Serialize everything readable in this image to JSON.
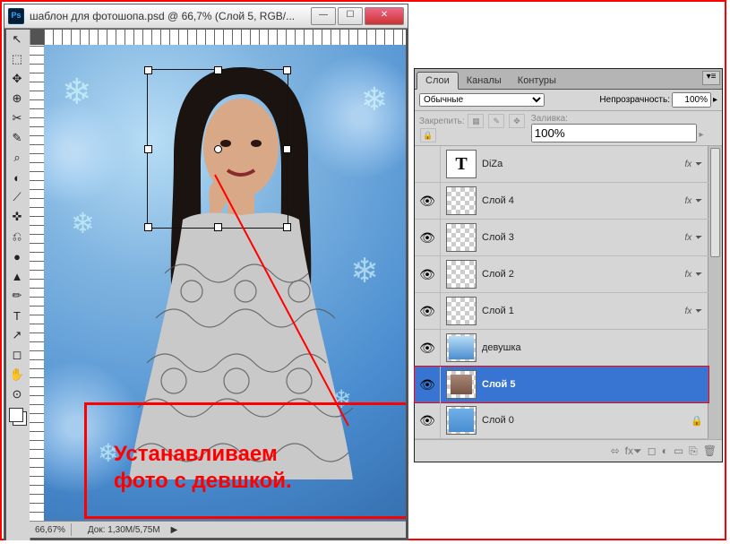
{
  "window": {
    "title": "шаблон для фотошопа.psd @ 66,7% (Слой 5, RGB/...",
    "minimize": "—",
    "maximize": "☐",
    "close": "✕"
  },
  "status": {
    "zoom": "66,67%",
    "doc_size": "Док: 1,30M/5,75M"
  },
  "callout": {
    "line1": "Устанавливаем",
    "line2": "фото с девшкой."
  },
  "panel": {
    "tabs": {
      "layers": "Слои",
      "channels": "Каналы",
      "paths": "Контуры"
    },
    "blend_mode": "Обычные",
    "opacity_label": "Непрозрачность:",
    "opacity_value": "100%",
    "lock_label": "Закрепить:",
    "fill_label": "Заливка:",
    "fill_value": "100%",
    "fx": "fx"
  },
  "layers": [
    {
      "name": "DiZa",
      "type": "text",
      "visible": false,
      "fx": true,
      "locked": false,
      "selected": false
    },
    {
      "name": "Слой 4",
      "type": "trans",
      "visible": true,
      "fx": true,
      "locked": false,
      "selected": false
    },
    {
      "name": "Слой 3",
      "type": "trans",
      "visible": true,
      "fx": true,
      "locked": false,
      "selected": false
    },
    {
      "name": "Слой 2",
      "type": "trans",
      "visible": true,
      "fx": true,
      "locked": false,
      "selected": false
    },
    {
      "name": "Слой 1",
      "type": "trans",
      "visible": true,
      "fx": true,
      "locked": false,
      "selected": false
    },
    {
      "name": "девушка",
      "type": "girl",
      "visible": true,
      "fx": false,
      "locked": false,
      "selected": false
    },
    {
      "name": "Слой 5",
      "type": "photo",
      "visible": true,
      "fx": false,
      "locked": false,
      "selected": true
    },
    {
      "name": "Слой 0",
      "type": "bg",
      "visible": true,
      "fx": false,
      "locked": true,
      "selected": false
    }
  ],
  "tools": [
    "↖",
    "⬚",
    "✥",
    "⊕",
    "✂",
    "✎",
    "⌕",
    "◐",
    "⟋",
    "✜",
    "⎌",
    "●",
    "▲",
    "✏",
    "T",
    "↗",
    "◻",
    "✋",
    "⊙"
  ]
}
